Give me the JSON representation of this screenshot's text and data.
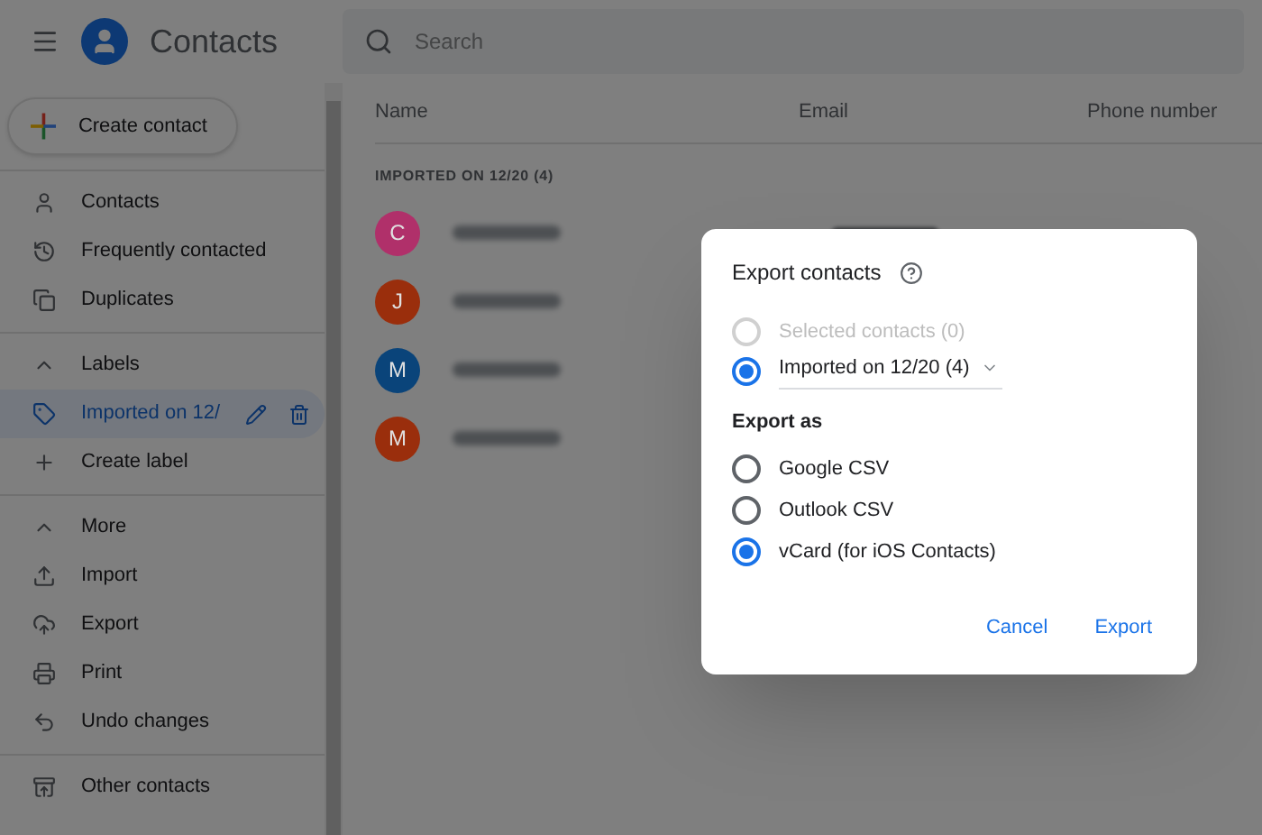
{
  "header": {
    "title": "Contacts",
    "search_placeholder": "Search"
  },
  "sidebar": {
    "create_button": "Create contact",
    "groups": [
      {
        "items": [
          {
            "kind": "nav",
            "label": "Contacts",
            "selected": false
          },
          {
            "kind": "nav",
            "label": "Frequently contacted",
            "selected": false
          },
          {
            "kind": "nav",
            "label": "Duplicates",
            "selected": false
          }
        ]
      },
      {
        "items": [
          {
            "kind": "header",
            "label": "Labels",
            "selected": false
          },
          {
            "kind": "label",
            "label": "Imported on 12/",
            "selected": true
          },
          {
            "kind": "nav",
            "label": "Create label",
            "selected": false
          }
        ]
      },
      {
        "items": [
          {
            "kind": "header",
            "label": "More",
            "selected": false
          },
          {
            "kind": "nav",
            "label": "Import",
            "selected": false
          },
          {
            "kind": "nav",
            "label": "Export",
            "selected": false
          },
          {
            "kind": "nav",
            "label": "Print",
            "selected": false
          },
          {
            "kind": "nav",
            "label": "Undo changes",
            "selected": false
          }
        ]
      },
      {
        "items": [
          {
            "kind": "nav",
            "label": "Other contacts",
            "selected": false
          }
        ]
      }
    ]
  },
  "table": {
    "columns": [
      "Name",
      "Email",
      "Phone number"
    ],
    "group_heading": "IMPORTED ON 12/20 (4)",
    "rows": [
      {
        "initial": "C",
        "color": "#b0306a"
      },
      {
        "initial": "J",
        "color": "#9a2e0c"
      },
      {
        "initial": "M",
        "color": "#0a447a"
      },
      {
        "initial": "M",
        "color": "#9a2e0c"
      }
    ]
  },
  "dialog": {
    "title": "Export contacts",
    "sources": [
      {
        "kind": "plain",
        "label": "Selected contacts (0)",
        "selected": false,
        "disabled": true
      },
      {
        "kind": "dropdown",
        "label": "Imported on 12/20 (4)",
        "selected": true,
        "disabled": false
      }
    ],
    "format_heading": "Export as",
    "formats": [
      {
        "label": "Google CSV",
        "selected": false
      },
      {
        "label": "Outlook CSV",
        "selected": false
      },
      {
        "label": "vCard (for iOS Contacts)",
        "selected": true
      }
    ],
    "buttons": [
      "Cancel",
      "Export"
    ]
  }
}
